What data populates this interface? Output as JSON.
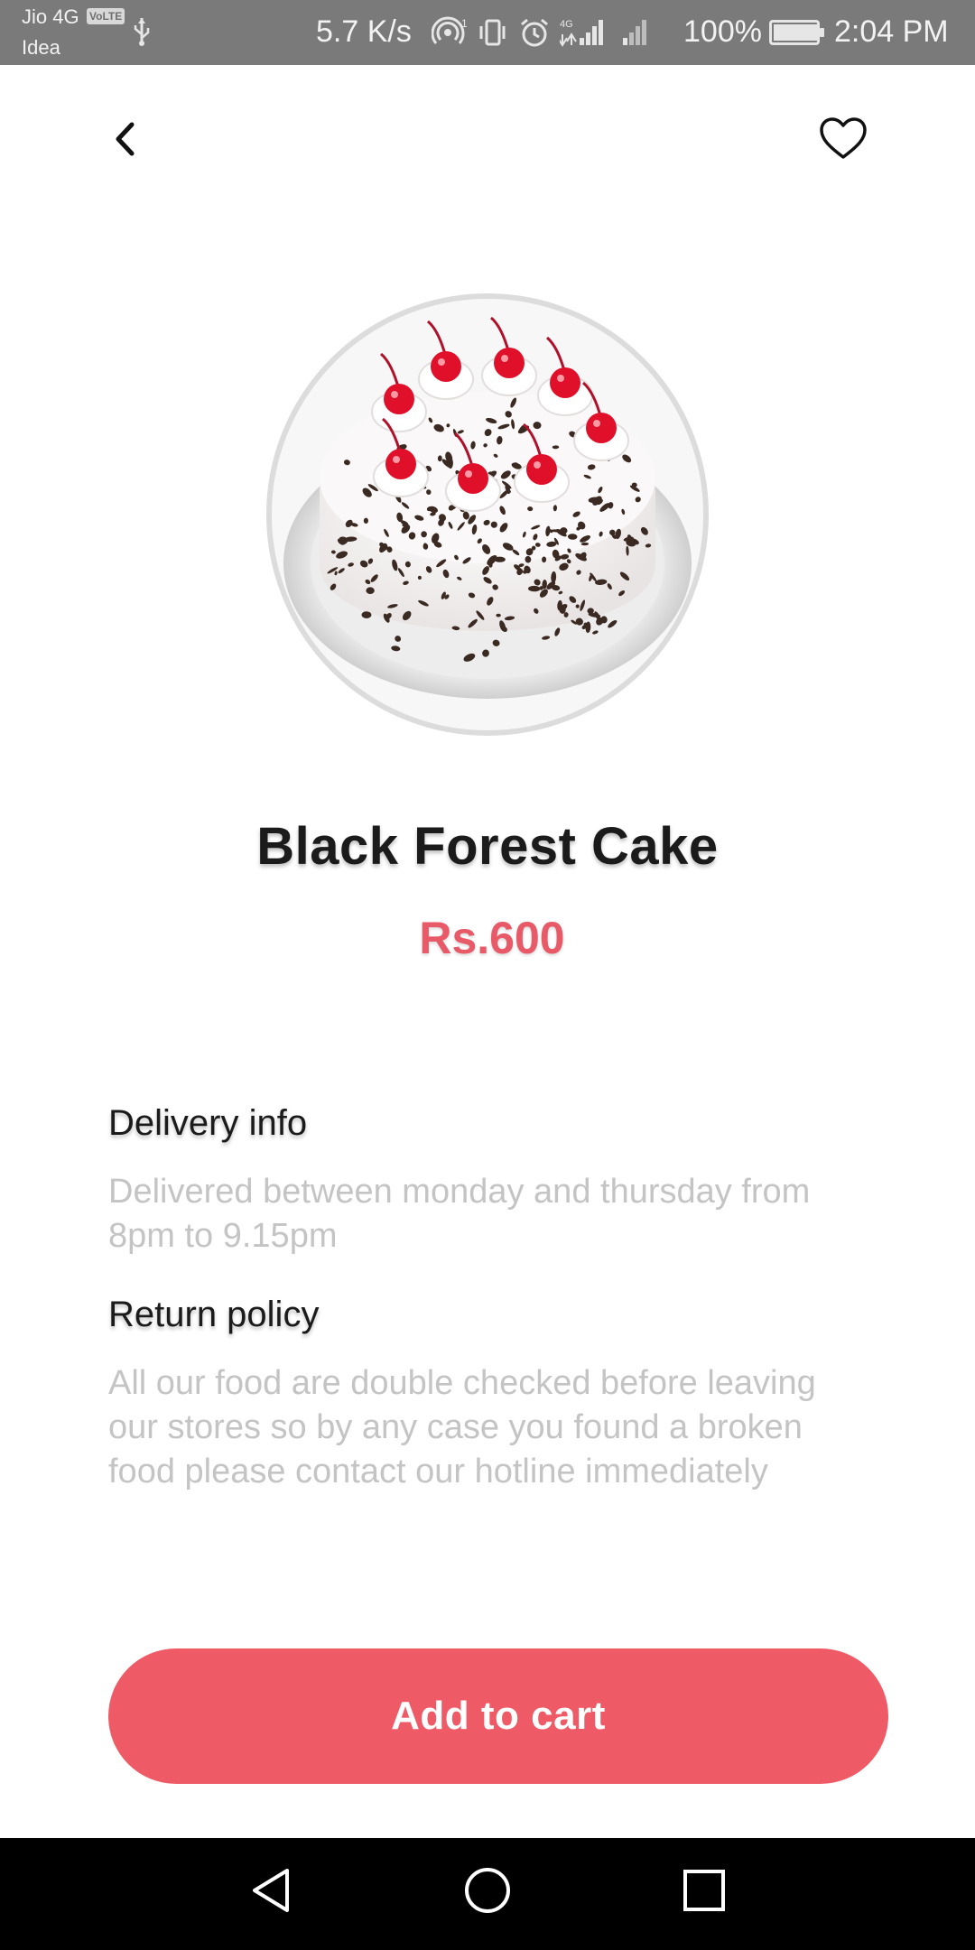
{
  "status_bar": {
    "carrier_primary": "Jio 4G",
    "volte_badge": "VoLTE",
    "carrier_secondary": "Idea",
    "network_speed": "5.7 K/s",
    "battery_percent_text": "100%",
    "battery_level": 1.0,
    "time": "2:04 PM"
  },
  "product": {
    "name": "Black Forest Cake",
    "price": "Rs.600",
    "image_icon": "black-forest-cake-image"
  },
  "delivery": {
    "title": "Delivery info",
    "body": "Delivered between monday and thursday from 8pm to 9.15pm"
  },
  "returns": {
    "title": "Return policy",
    "body": "All our food are double checked before leaving our stores so by any case you found a broken food please contact our hotline immediately"
  },
  "actions": {
    "add_to_cart": "Add to cart"
  },
  "colors": {
    "accent": "#ef5a67",
    "price": "#e85a67",
    "muted_text": "#c4c4c4"
  }
}
